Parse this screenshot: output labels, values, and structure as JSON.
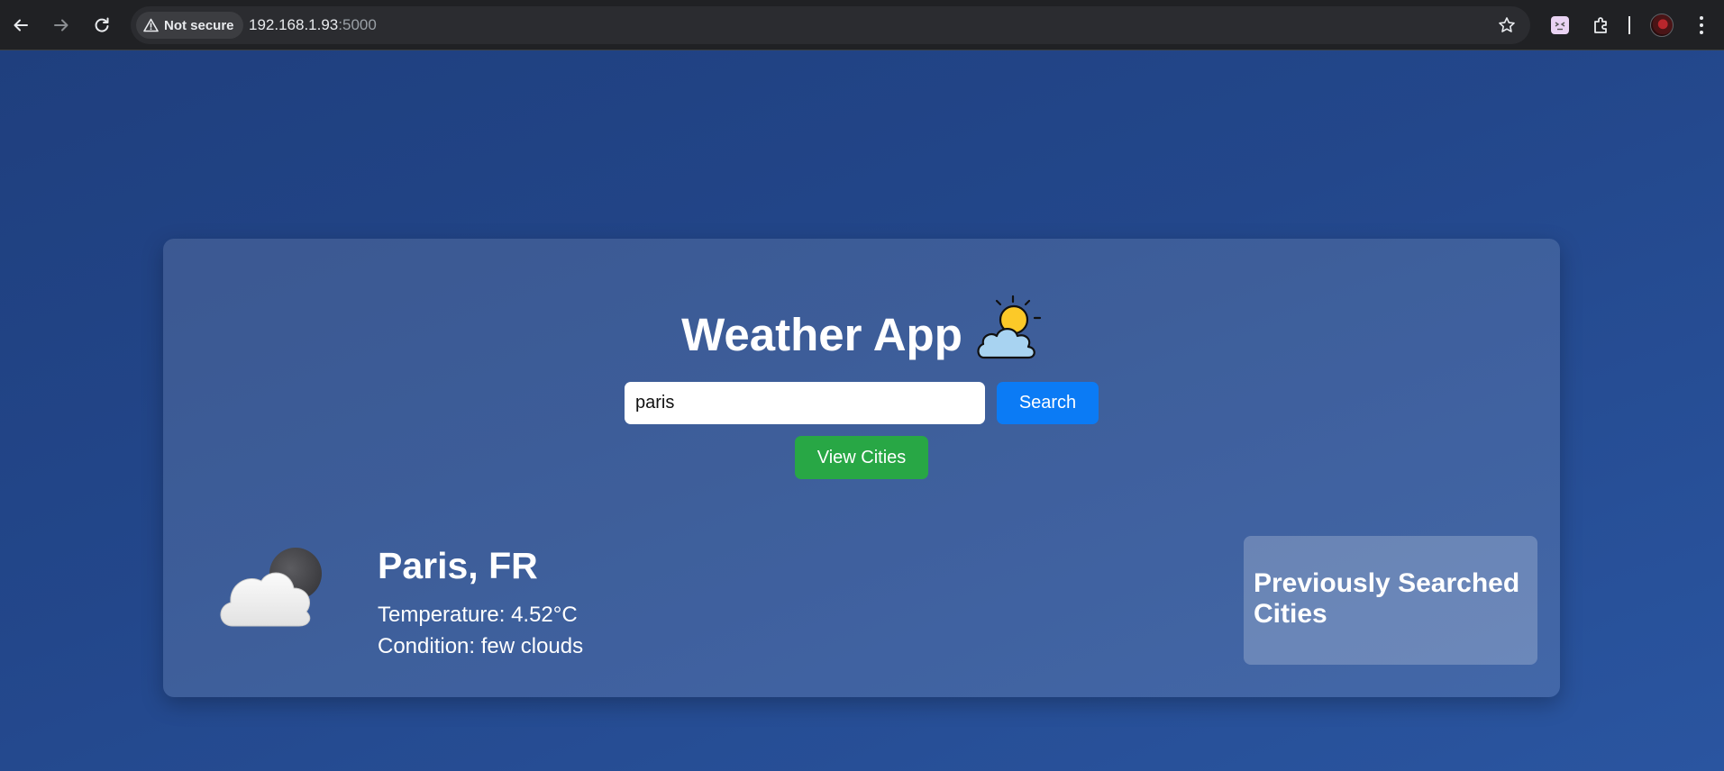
{
  "browser": {
    "security_label": "Not secure",
    "url_host": "192.168.1.93",
    "url_port": ":5000",
    "icons": {
      "back": "back-arrow-icon",
      "forward": "forward-arrow-icon",
      "reload": "reload-icon",
      "warning": "warning-triangle-icon",
      "bookmark": "star-icon",
      "extension_app": "extension-app-icon",
      "extensions": "puzzle-icon",
      "profile": "avatar",
      "menu": "kebab-menu-icon"
    }
  },
  "app": {
    "title": "Weather App",
    "title_icon": "sun-behind-cloud-icon",
    "search": {
      "value": "paris",
      "button_label": "Search"
    },
    "view_cities_label": "View Cities",
    "current": {
      "icon": "cloud-with-moon-icon",
      "location": "Paris, FR",
      "temperature_text": "Temperature: 4.52°C",
      "condition_text": "Condition: few clouds"
    },
    "history": {
      "title": "Previously Searched Cities",
      "items": []
    }
  },
  "colors": {
    "background": "#23478b",
    "search_button": "#0b7bf5",
    "view_cities_button": "#28a745"
  }
}
